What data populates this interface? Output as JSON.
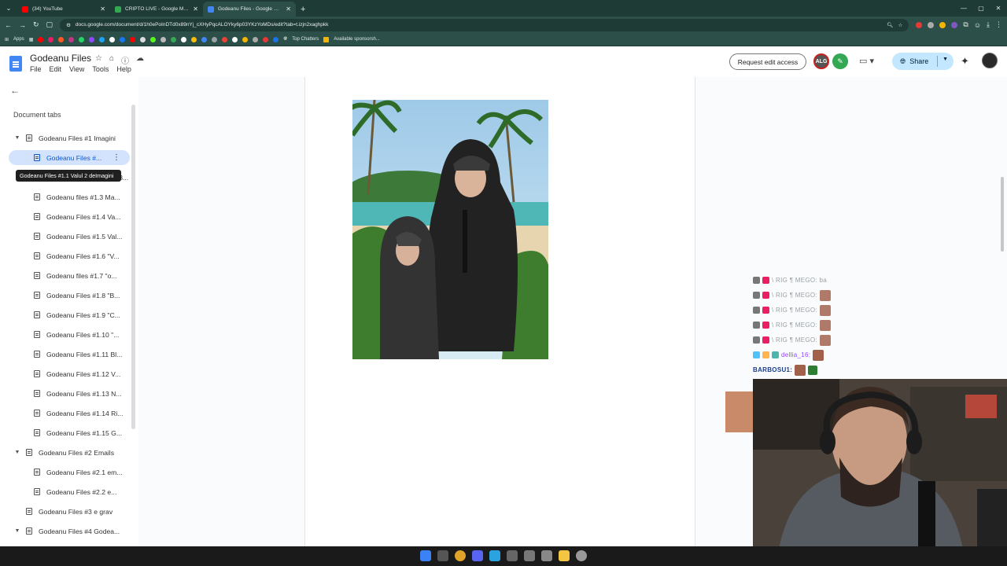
{
  "browser": {
    "tabs": [
      {
        "title": "(34) YouTube",
        "color": "#ff0000"
      },
      {
        "title": "CRIPTO LIVE - Google Maps",
        "color": "#34a853"
      },
      {
        "title": "Godeanu Files - Google Docs",
        "color": "#4285f4"
      }
    ],
    "url": "docs.google.com/document/d/1h0ePoInDTd0x89nYj_cXHyPqcALOYky6p03YKzYoMDs/edit?tab=t.izjn2xaghpkk",
    "bookmarks": {
      "apps": "Apps",
      "top_chatters": "Top Chatters",
      "sponsors": "Available sponsorsh..."
    }
  },
  "docs": {
    "title": "Godeanu Files",
    "menu": [
      "File",
      "Edit",
      "View",
      "Tools",
      "Help"
    ],
    "request_edit": "Request edit access",
    "share": "Share",
    "avatar_a": "ALG"
  },
  "sidebar": {
    "heading": "Document tabs",
    "tooltip": "Godeanu Files #1.1 Valul 2 deImagini",
    "items": [
      {
        "label": "Godeanu Files #1 Imagini",
        "level": 0,
        "caret": true
      },
      {
        "label": "Godeanu Files #...",
        "level": 1,
        "selected": true
      },
      {
        "label": "Godeanu Files #1.2 Valul 3...",
        "level": 1
      },
      {
        "label": "Godeanu files #1.3 Ma...",
        "level": 1
      },
      {
        "label": "Godeanu Files #1.4 Va...",
        "level": 1
      },
      {
        "label": "Godeanu Files #1.5 Val...",
        "level": 1
      },
      {
        "label": "Godeanu Files #1.6 \"V...",
        "level": 1
      },
      {
        "label": "Godeanu files #1.7 \"o...",
        "level": 1
      },
      {
        "label": "Godeanu Files #1.8 \"B...",
        "level": 1
      },
      {
        "label": "Godeanu Files #1.9 \"C...",
        "level": 1
      },
      {
        "label": "Godeanu Files #1.10 \"...",
        "level": 1
      },
      {
        "label": "Godeanu Files #1.11 Bl...",
        "level": 1
      },
      {
        "label": "Godeanu Files #1.12 V...",
        "level": 1
      },
      {
        "label": "Godeanu Files #1.13 N...",
        "level": 1
      },
      {
        "label": "Godeanu Files #1.14 Ri...",
        "level": 1
      },
      {
        "label": "Godeanu Files #1.15 G...",
        "level": 1
      },
      {
        "label": "Godeanu Files #2 Emails",
        "level": 0,
        "caret": true
      },
      {
        "label": "Godeanu Files #2.1 em...",
        "level": 1
      },
      {
        "label": "Godeanu Files #2.2 e...",
        "level": 1
      },
      {
        "label": "Godeanu Files #3 e grav",
        "level": 0
      },
      {
        "label": "Godeanu Files #4 Godea...",
        "level": 0,
        "caret": true
      }
    ]
  },
  "chat": [
    {
      "name": "\\ RIG ¶ MEGO: ba",
      "style": "faded"
    },
    {
      "name": "\\ RIG ¶ MEGO:",
      "style": "faded"
    },
    {
      "name": "\\ RIG ¶ MEGO:",
      "style": "faded"
    },
    {
      "name": "\\ RIG ¶ MEGO:",
      "style": "faded"
    },
    {
      "name": "\\ RIG ¶ MEGO:",
      "style": "faded"
    },
    {
      "name": "dellia_16:",
      "style": "purple"
    },
    {
      "name": "BARBOSU1:",
      "style": "bold"
    }
  ]
}
